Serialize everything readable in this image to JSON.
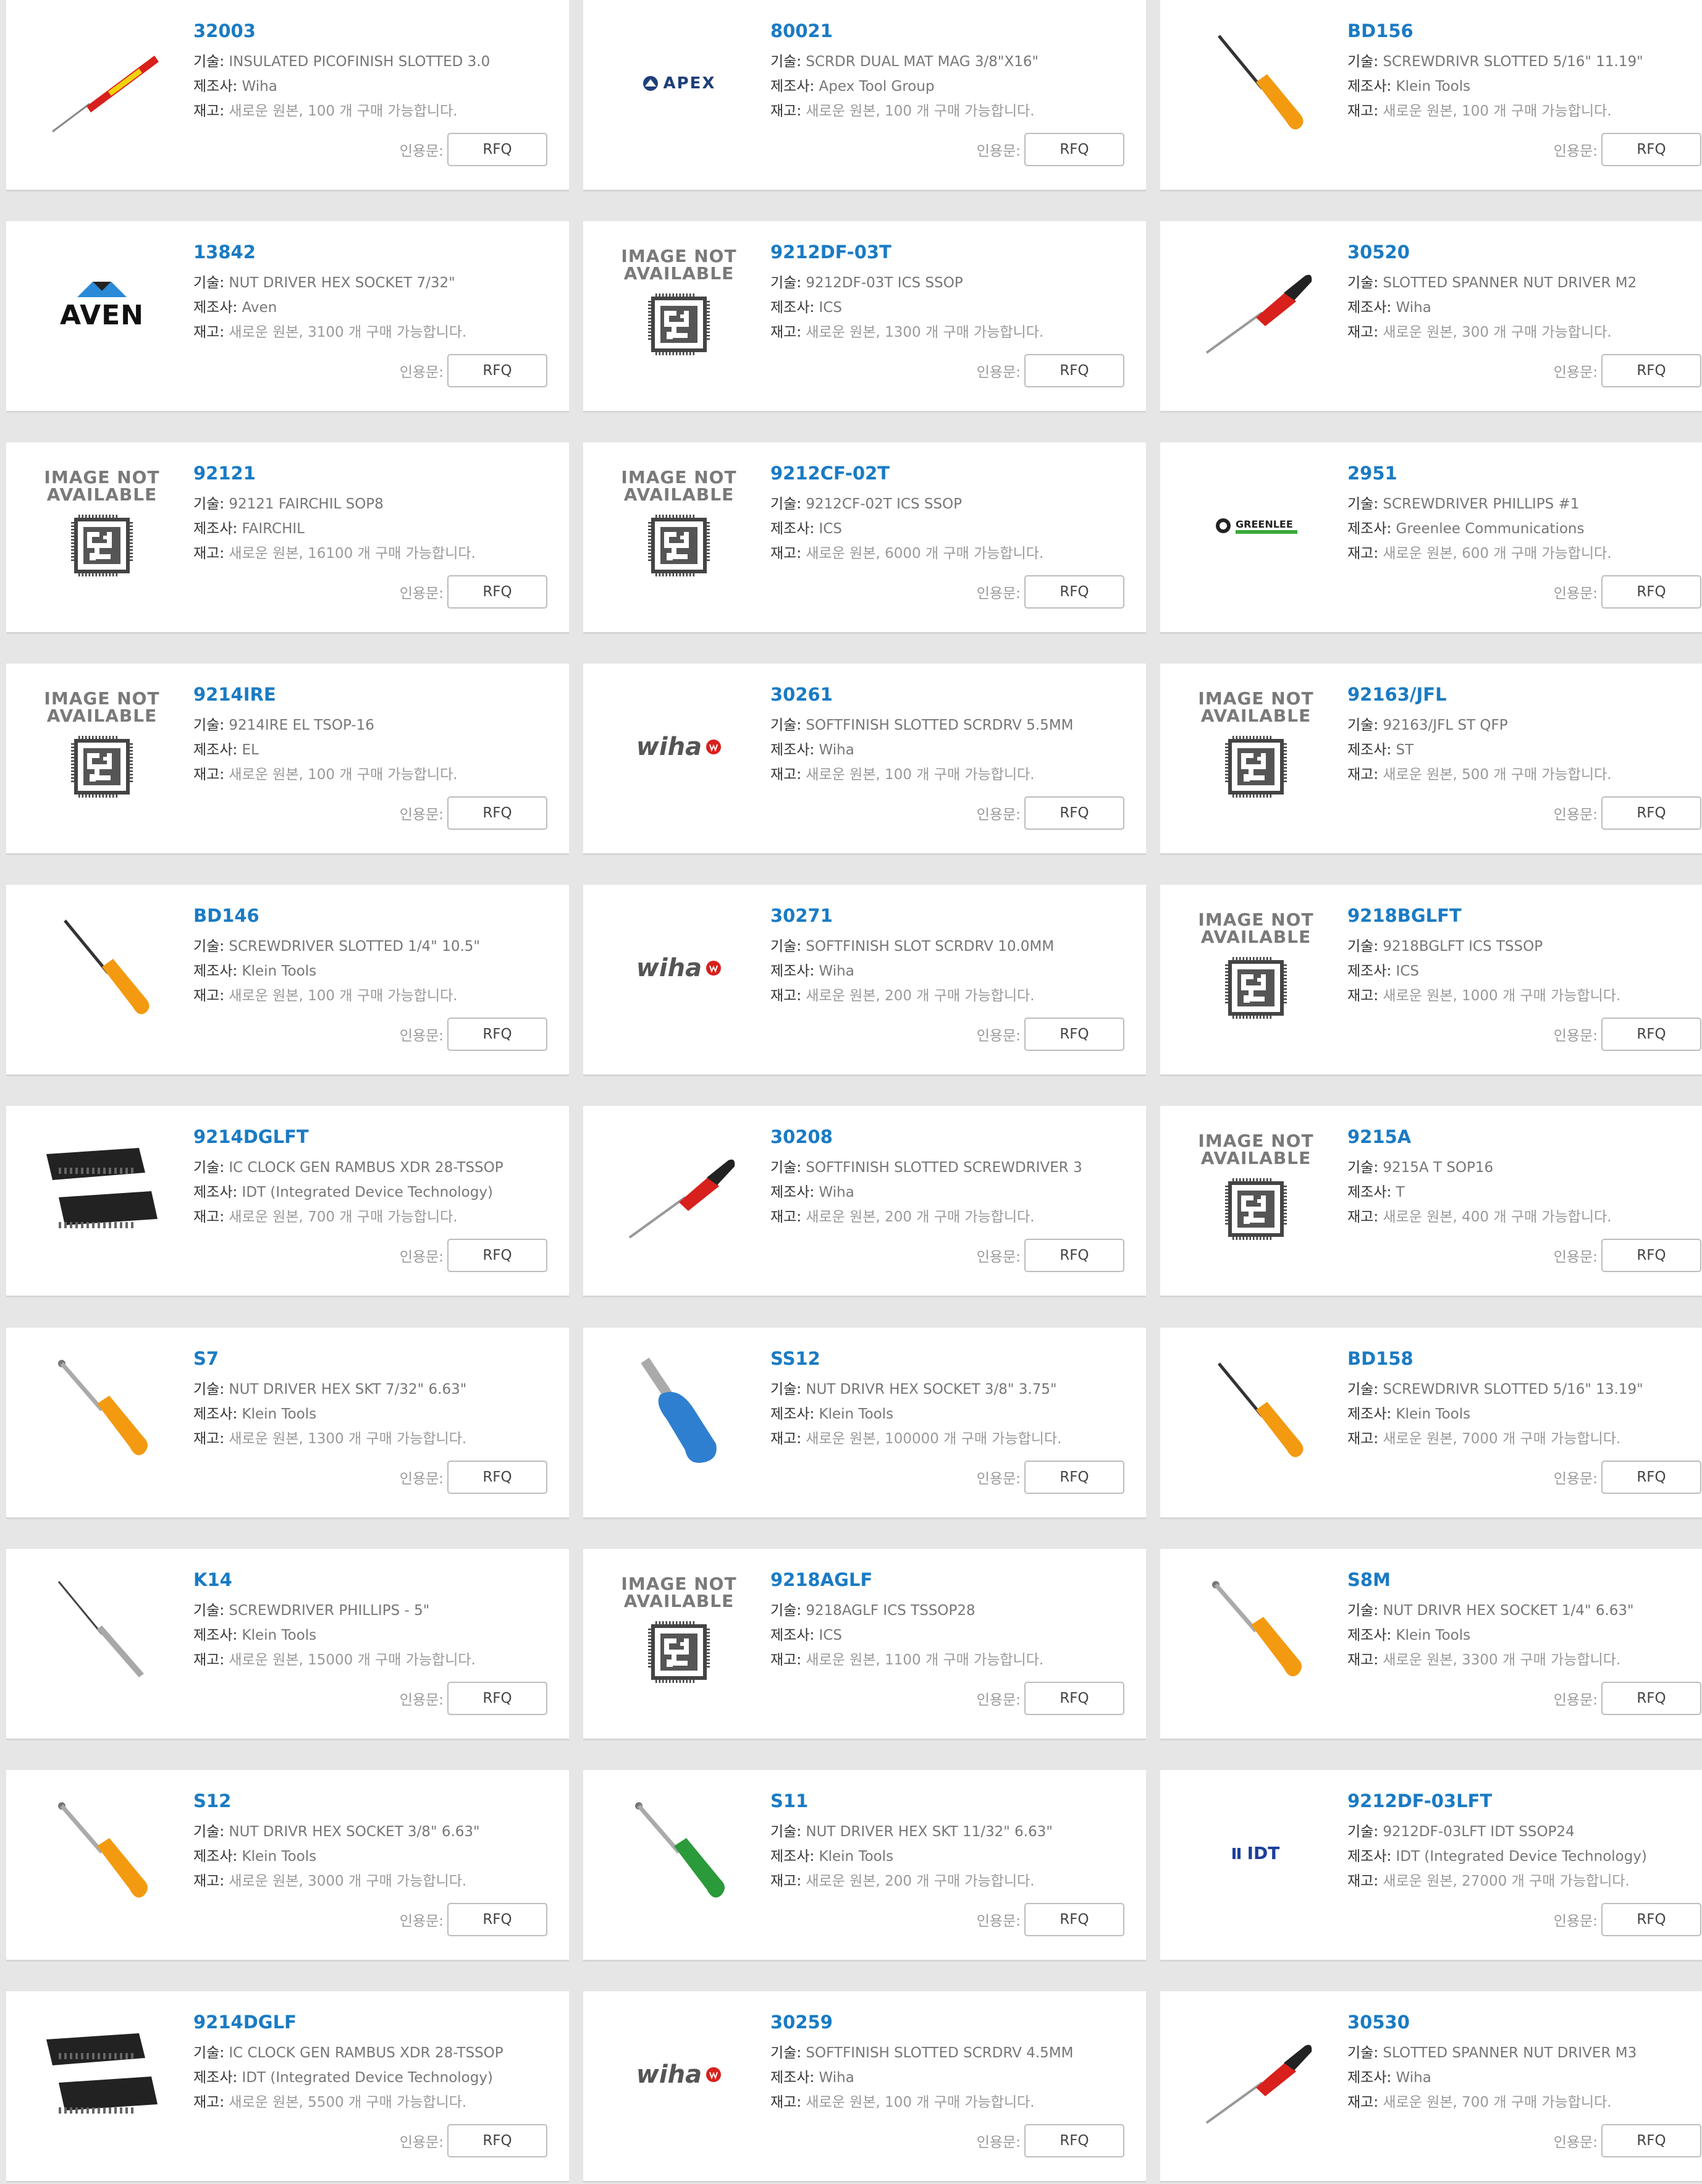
{
  "labels": {
    "desc": "기술:",
    "mfr": "제조사:",
    "stock": "재고:",
    "quote": "인용문:",
    "rfq": "RFQ",
    "stock_prefix": "새로운 원본,",
    "stock_suffix": "개 구매 가능합니다.",
    "ina_line1": "IMAGE NOT",
    "ina_line2": "AVAILABLE"
  },
  "products": [
    {
      "pn": "32003",
      "desc": "INSULATED PICOFINISH SLOTTED 3.0",
      "mfr": "Wiha",
      "qty": "100",
      "img": "red-screwdriver-icon"
    },
    {
      "pn": "80021",
      "desc": "SCRDR DUAL MAT MAG 3/8\"X16\"",
      "mfr": "Apex Tool Group",
      "qty": "100",
      "img": "apex-logo-icon"
    },
    {
      "pn": "BD156",
      "desc": "SCREWDRIVR SLOTTED 5/16\" 11.19\"",
      "mfr": "Klein Tools",
      "qty": "100",
      "img": "orange-screwdriver-icon"
    },
    {
      "pn": "13842",
      "desc": "NUT DRIVER HEX SOCKET 7/32\"",
      "mfr": "Aven",
      "qty": "3100",
      "img": "aven-logo-icon"
    },
    {
      "pn": "9212DF-03T",
      "desc": "9212DF-03T ICS SSOP",
      "mfr": "ICS",
      "qty": "1300",
      "img": "image-not-available-icon"
    },
    {
      "pn": "30520",
      "desc": "SLOTTED SPANNER NUT DRIVER M2",
      "mfr": "Wiha",
      "qty": "300",
      "img": "red-black-driver-icon"
    },
    {
      "pn": "92121",
      "desc": "92121 FAIRCHIL SOP8",
      "mfr": "FAIRCHIL",
      "qty": "16100",
      "img": "image-not-available-icon"
    },
    {
      "pn": "9212CF-02T",
      "desc": "9212CF-02T ICS SSOP",
      "mfr": "ICS",
      "qty": "6000",
      "img": "image-not-available-icon"
    },
    {
      "pn": "2951",
      "desc": "SCREWDRIVER PHILLIPS #1",
      "mfr": "Greenlee Communications",
      "qty": "600",
      "img": "greenlee-logo-icon"
    },
    {
      "pn": "9214IRE",
      "desc": "9214IRE EL TSOP-16",
      "mfr": "EL",
      "qty": "100",
      "img": "image-not-available-icon"
    },
    {
      "pn": "30261",
      "desc": "SOFTFINISH SLOTTED SCRDRV 5.5MM",
      "mfr": "Wiha",
      "qty": "100",
      "img": "wiha-logo-icon"
    },
    {
      "pn": "92163/JFL",
      "desc": "92163/JFL ST QFP",
      "mfr": "ST",
      "qty": "500",
      "img": "image-not-available-icon"
    },
    {
      "pn": "BD146",
      "desc": "SCREWDRIVER SLOTTED 1/4\" 10.5\"",
      "mfr": "Klein Tools",
      "qty": "100",
      "img": "orange-screwdriver-icon"
    },
    {
      "pn": "30271",
      "desc": "SOFTFINISH SLOT SCRDRV 10.0MM",
      "mfr": "Wiha",
      "qty": "200",
      "img": "wiha-logo-icon"
    },
    {
      "pn": "9218BGLFT",
      "desc": "9218BGLFT ICS TSSOP",
      "mfr": "ICS",
      "qty": "1000",
      "img": "image-not-available-icon"
    },
    {
      "pn": "9214DGLFT",
      "desc": "IC CLOCK GEN RAMBUS XDR 28-TSSOP",
      "mfr": "IDT (Integrated Device Technology)",
      "qty": "700",
      "img": "tssop-chip-icon"
    },
    {
      "pn": "30208",
      "desc": "SOFTFINISH SLOTTED SCREWDRIVER 3",
      "mfr": "Wiha",
      "qty": "200",
      "img": "red-black-driver-icon"
    },
    {
      "pn": "9215A",
      "desc": "9215A T SOP16",
      "mfr": "T",
      "qty": "400",
      "img": "image-not-available-icon"
    },
    {
      "pn": "S7",
      "desc": "NUT DRIVER HEX SKT 7/32\" 6.63\"",
      "mfr": "Klein Tools",
      "qty": "1300",
      "img": "orange-nutdriver-icon"
    },
    {
      "pn": "SS12",
      "desc": "NUT DRIVR HEX SOCKET 3/8\" 3.75\"",
      "mfr": "Klein Tools",
      "qty": "100000",
      "img": "blue-nutdriver-icon"
    },
    {
      "pn": "BD158",
      "desc": "SCREWDRIVR SLOTTED 5/16\" 13.19\"",
      "mfr": "Klein Tools",
      "qty": "7000",
      "img": "orange-screwdriver-icon"
    },
    {
      "pn": "K14",
      "desc": "SCREWDRIVER PHILLIPS - 5\"",
      "mfr": "Klein Tools",
      "qty": "15000",
      "img": "silver-screwdriver-icon"
    },
    {
      "pn": "9218AGLF",
      "desc": "9218AGLF ICS TSSOP28",
      "mfr": "ICS",
      "qty": "1100",
      "img": "image-not-available-icon"
    },
    {
      "pn": "S8M",
      "desc": "NUT DRIVR HEX SOCKET 1/4\" 6.63\"",
      "mfr": "Klein Tools",
      "qty": "3300",
      "img": "orange-nutdriver-icon"
    },
    {
      "pn": "S12",
      "desc": "NUT DRIVR HEX SOCKET 3/8\" 6.63\"",
      "mfr": "Klein Tools",
      "qty": "3000",
      "img": "orange-nutdriver-icon"
    },
    {
      "pn": "S11",
      "desc": "NUT DRIVER HEX SKT 11/32\" 6.63\"",
      "mfr": "Klein Tools",
      "qty": "200",
      "img": "green-nutdriver-icon"
    },
    {
      "pn": "9212DF-03LFT",
      "desc": "9212DF-03LFT IDT SSOP24",
      "mfr": "IDT (Integrated Device Technology)",
      "qty": "27000",
      "img": "idt-logo-icon"
    },
    {
      "pn": "9214DGLF",
      "desc": "IC CLOCK GEN RAMBUS XDR 28-TSSOP",
      "mfr": "IDT (Integrated Device Technology)",
      "qty": "5500",
      "img": "tssop-chip-icon"
    },
    {
      "pn": "30259",
      "desc": "SOFTFINISH SLOTTED SCRDRV 4.5MM",
      "mfr": "Wiha",
      "qty": "100",
      "img": "wiha-logo-icon"
    },
    {
      "pn": "30530",
      "desc": "SLOTTED SPANNER NUT DRIVER M3",
      "mfr": "Wiha",
      "qty": "700",
      "img": "red-black-driver-icon"
    }
  ],
  "logos": {
    "apex": "APEX",
    "aven": "AVEN",
    "greenlee": "GREENLEE",
    "wiha": "wiha",
    "idt": "IDT"
  },
  "colors": {
    "part_number": "#1a7bc4",
    "background": "#e6e6e6",
    "card": "#ffffff"
  }
}
